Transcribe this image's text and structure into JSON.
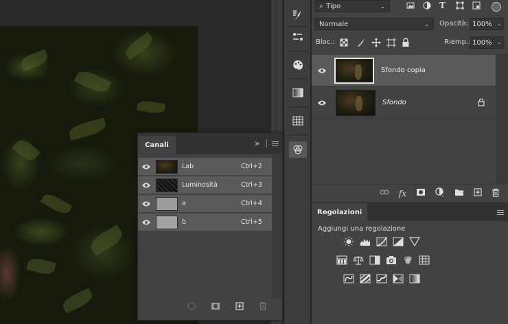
{
  "layers_panel": {
    "filter_kind": "Tipo",
    "blend_mode": "Normale",
    "opacity_label": "Opacità:",
    "opacity_value": "100%",
    "lock_label": "Bloc.:",
    "fill_label": "Riemp.:",
    "fill_value": "100%",
    "layers": [
      {
        "name": "Sfondo copia",
        "italic": false,
        "locked": false,
        "selected": true
      },
      {
        "name": "Sfondo",
        "italic": true,
        "locked": true,
        "selected": false
      }
    ]
  },
  "adjustments_panel": {
    "tab_label": "Regolazioni",
    "add_label": "Aggiungi una regolazione",
    "rows": [
      [
        "brightness-contrast-icon",
        "levels-icon",
        "curves-icon",
        "exposure-icon",
        "gradient-map-triangle-icon"
      ],
      [
        "vibrance-icon",
        "color-balance-icon",
        "black-white-icon",
        "photo-filter-icon",
        "channel-mixer-icon",
        "color-lookup-icon"
      ],
      [
        "invert-icon",
        "posterize-icon",
        "threshold-icon",
        "selective-color-icon",
        "gradient-map-icon"
      ]
    ]
  },
  "channels_panel": {
    "tab_label": "Canali",
    "expand_glyph": "»",
    "channels": [
      {
        "name": "Lab",
        "shortcut": "Ctrl+2",
        "thumb": "color"
      },
      {
        "name": "Luminosità",
        "shortcut": "Ctrl+3",
        "thumb": "noise"
      },
      {
        "name": "a",
        "shortcut": "Ctrl+4",
        "thumb": "gray"
      },
      {
        "name": "b",
        "shortcut": "Ctrl+5",
        "thumb": "gray"
      }
    ]
  },
  "colors": {
    "panel_bg": "#424242",
    "row_selected": "#5a5a5a",
    "dark_bg": "#282828"
  }
}
